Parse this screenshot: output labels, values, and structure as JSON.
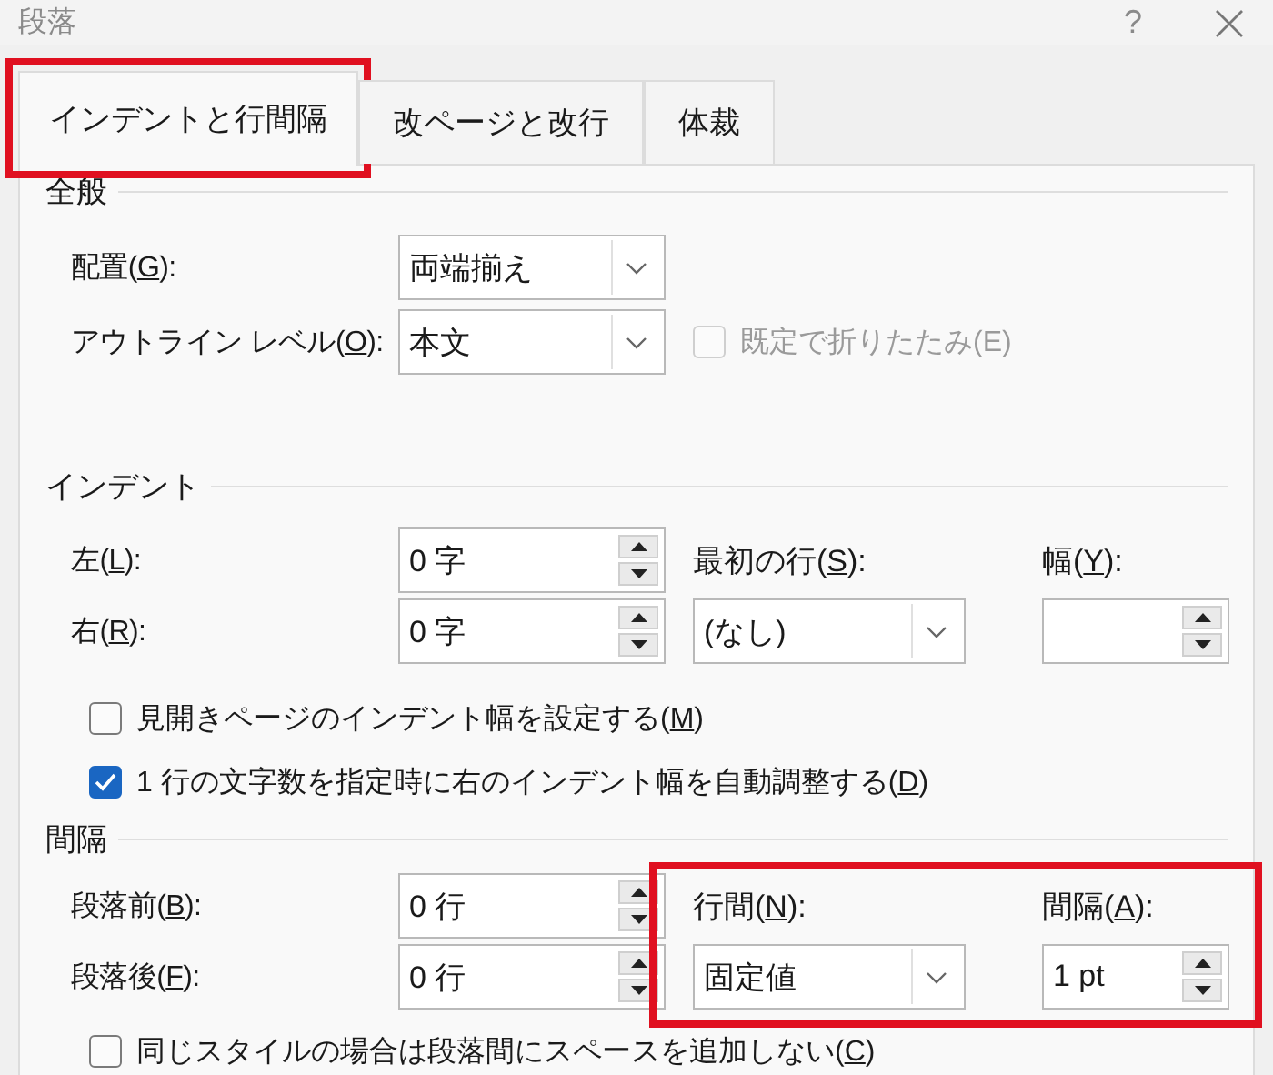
{
  "window": {
    "title": "段落",
    "help": "?"
  },
  "tabs": [
    {
      "label": "インデントと行間隔",
      "selected": true,
      "highlighted": true
    },
    {
      "label": "改ページと改行",
      "selected": false,
      "highlighted": false
    },
    {
      "label": "体裁",
      "selected": false,
      "highlighted": false
    }
  ],
  "sections": [
    {
      "title": "全般",
      "rows": [
        {
          "label": [
            "配置(",
            "G",
            "):"
          ],
          "control": {
            "kind": "dropdown",
            "value": "両端揃え"
          }
        },
        {
          "label": [
            "アウトライン レベル(",
            "O",
            "):"
          ],
          "control": {
            "kind": "dropdown",
            "value": "本文"
          },
          "extra": {
            "label": "既定で折りたたみ(E)",
            "checked": false,
            "disabled": true
          }
        }
      ]
    },
    {
      "title": "インデント",
      "rows": [
        {
          "label": [
            "左(",
            "L",
            "):"
          ],
          "control": {
            "kind": "spinner",
            "value": "0 字"
          }
        },
        {
          "label": [
            "右(",
            "R",
            "):"
          ],
          "control": {
            "kind": "spinner",
            "value": "0 字"
          }
        }
      ],
      "group": {
        "highlighted": false,
        "fields": [
          {
            "label": [
              "最初の行(",
              "S",
              "):"
            ],
            "control": {
              "kind": "dropdown",
              "value": "(なし)"
            }
          },
          {
            "label": [
              "幅(",
              "Y",
              "):"
            ],
            "control": {
              "kind": "spinner"
            }
          }
        ]
      },
      "checkboxes": [
        {
          "label": [
            "見開きページのインデント幅を設定する(",
            "M",
            ")"
          ],
          "checked": false
        },
        {
          "label": [
            "1 行の文字数を指定時に右のインデント幅を自動調整する(",
            "D",
            ")"
          ],
          "checked": true
        }
      ]
    },
    {
      "title": "間隔",
      "rows": [
        {
          "label": [
            "段落前(",
            "B",
            "):"
          ],
          "control": {
            "kind": "spinner",
            "value": "0 行"
          }
        },
        {
          "label": [
            "段落後(",
            "F",
            "):"
          ],
          "control": {
            "kind": "spinner",
            "value": "0 行"
          }
        }
      ],
      "group": {
        "highlighted": true,
        "fields": [
          {
            "label": [
              "行間(",
              "N",
              "):"
            ],
            "control": {
              "kind": "dropdown",
              "value": "固定値"
            }
          },
          {
            "label": [
              "間隔(",
              "A",
              "):"
            ],
            "control": {
              "kind": "spinner",
              "value": "1 pt"
            }
          }
        ]
      },
      "checkboxes": [
        {
          "label": [
            "同じスタイルの場合は段落間にスペースを追加しない(",
            "C",
            ")"
          ],
          "checked": false
        }
      ]
    }
  ]
}
